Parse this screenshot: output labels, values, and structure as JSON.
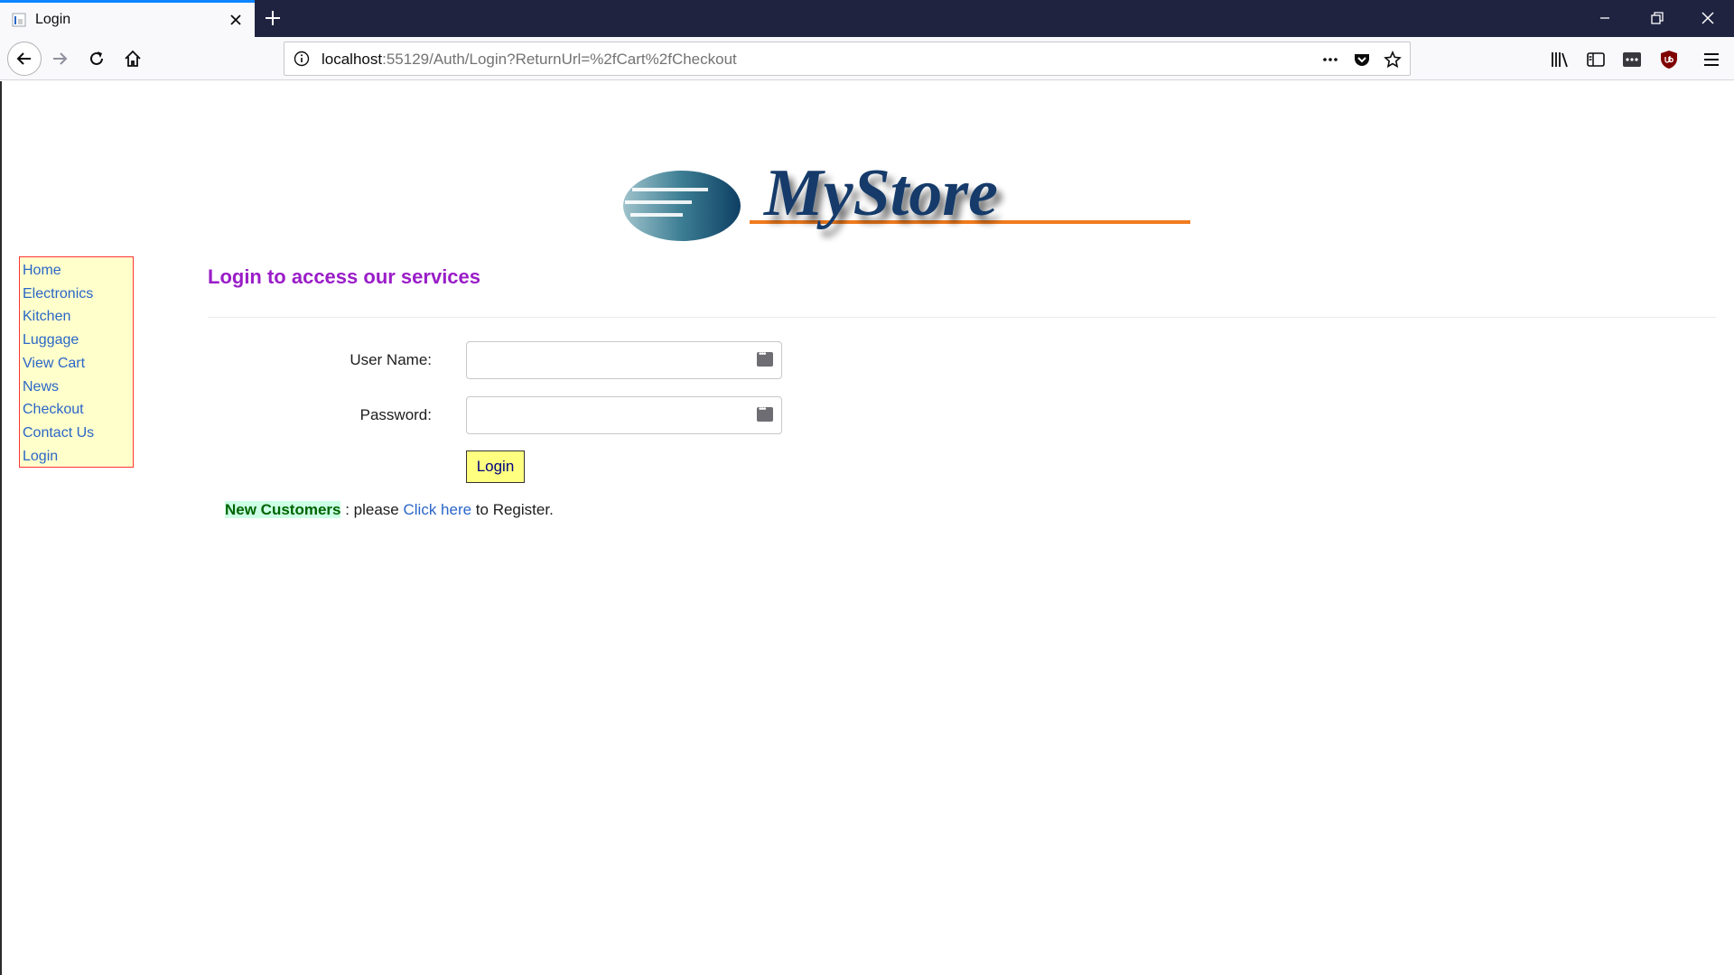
{
  "browser": {
    "tab_title": "Login",
    "url_host": "localhost",
    "url_rest": ":55129/Auth/Login?ReturnUrl=%2fCart%2fCheckout",
    "accent": "#0a84ff",
    "tabbar_color": "#202340"
  },
  "logo": {
    "text": "MyStore"
  },
  "nav": {
    "items": [
      "Home",
      "Electronics",
      "Kitchen",
      "Luggage",
      "View Cart",
      "News",
      "Checkout",
      "Contact Us",
      "Login"
    ]
  },
  "main": {
    "heading": "Login to access our services",
    "username_label": "User Name:",
    "username_value": "",
    "password_label": "Password:",
    "password_value": "",
    "login_button": "Login",
    "register_prefix": "New Customers",
    "register_mid": " : please ",
    "register_link": "Click here",
    "register_suffix": " to Register."
  },
  "colors": {
    "heading": "#9a1dc8",
    "sidebar_bg": "#ffffcc",
    "sidebar_border": "#ff3333",
    "link": "#2a66c7",
    "button_bg": "#ffff80",
    "new_customers_bg": "#ccffe6"
  }
}
